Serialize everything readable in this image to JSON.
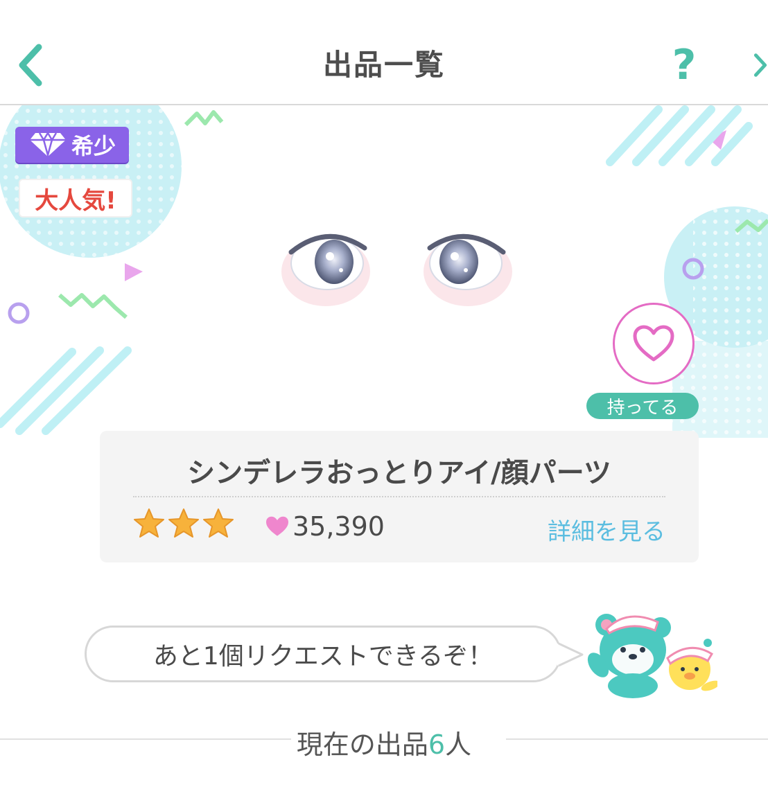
{
  "header": {
    "title": "出品一覧",
    "help_label": "?",
    "back_icon": "chevron-left-icon",
    "next_icon": "chevron-right-icon"
  },
  "badges": {
    "rare_label": "希少",
    "rare_icon": "diamond-icon",
    "popular_label": "大人気!"
  },
  "item": {
    "owned_label": "持ってる",
    "name": "シンデレラおっとりアイ/顔パーツ",
    "rarity_stars": 3,
    "likes": "35,390",
    "detail_link": "詳細を見る"
  },
  "message": "あと1個リクエストできるぞ！",
  "footer": {
    "prefix": "現在の出品",
    "count": "6",
    "suffix": "人"
  },
  "colors": {
    "accent_teal": "#4dbfa9",
    "rare_purple": "#8a63e8",
    "popular_red": "#e5483e",
    "heart_pink": "#e46bc4",
    "link_blue": "#5bbde0"
  }
}
